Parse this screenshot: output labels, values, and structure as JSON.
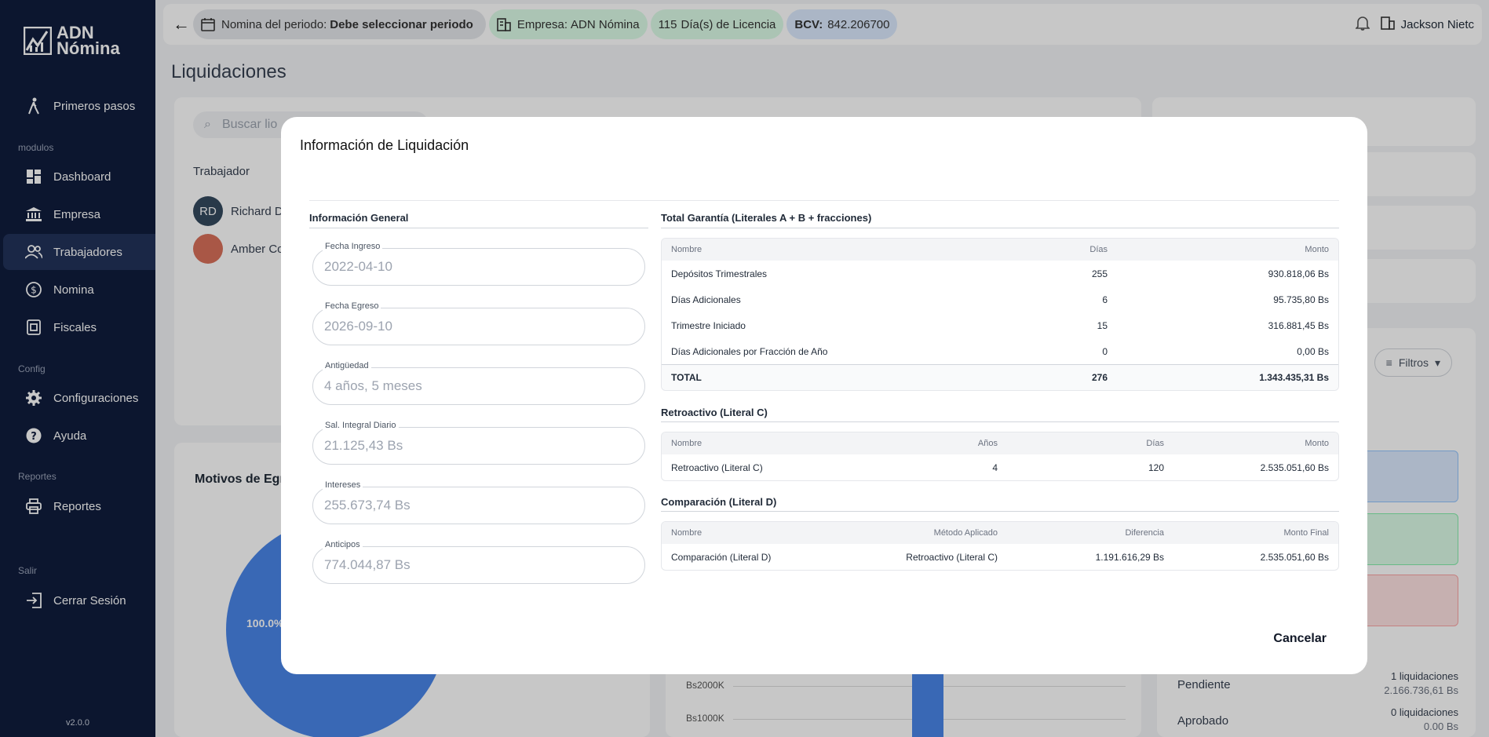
{
  "brand": {
    "line1": "ADN",
    "line2": "Nómina"
  },
  "sidebar": {
    "items": [
      {
        "label": "Primeros pasos",
        "icon": "walk-icon"
      },
      {
        "label": "Dashboard",
        "icon": "dashboard-icon"
      },
      {
        "label": "Empresa",
        "icon": "bank-icon"
      },
      {
        "label": "Trabajadores",
        "icon": "people-icon"
      },
      {
        "label": "Nomina",
        "icon": "money-icon"
      },
      {
        "label": "Fiscales",
        "icon": "receipt-icon"
      },
      {
        "label": "Configuraciones",
        "icon": "gear-icon"
      },
      {
        "label": "Ayuda",
        "icon": "help-icon"
      },
      {
        "label": "Reportes",
        "icon": "printer-icon"
      },
      {
        "label": "Cerrar Sesión",
        "icon": "logout-icon"
      }
    ],
    "sections": [
      "modulos",
      "Config",
      "Reportes",
      "Salir"
    ],
    "version": "v2.0.0"
  },
  "topbar": {
    "periodo_label": "Nomina del periodo:",
    "periodo_value": "Debe seleccionar periodo",
    "empresa_label": "Empresa:",
    "empresa_value": "ADN Nómina",
    "licencia_num": "115",
    "licencia_text": "Día(s) de Licencia",
    "bcv_label": "BCV:",
    "bcv_value": "842.206700",
    "user": "Jackson Nietc"
  },
  "page": {
    "title": "Liquidaciones",
    "search_placeholder": "Buscar lio",
    "col_trabajador": "Trabajador",
    "workers": [
      {
        "initials": "RD",
        "name": "Richard D"
      },
      {
        "initials": "",
        "name": "Amber Co"
      }
    ],
    "motivos_title": "Motivos de Egre",
    "pie_label": "100.0%",
    "filtros": "Filtros",
    "bar_ticks": [
      "Bs2000K",
      "Bs1000K"
    ],
    "status": [
      {
        "label": "Pendiente",
        "count": "1 liquidaciones",
        "amount": "2.166.736,61 Bs"
      },
      {
        "label": "Aprobado",
        "count": "0 liquidaciones",
        "amount": "0.00 Bs"
      }
    ]
  },
  "modal": {
    "title": "Información de Liquidación",
    "general_title": "Información General",
    "fields": [
      {
        "label": "Fecha Ingreso",
        "value": "2022-04-10"
      },
      {
        "label": "Fecha Egreso",
        "value": "2026-09-10"
      },
      {
        "label": "Antigüedad",
        "value": "4 años, 5 meses"
      },
      {
        "label": "Sal. Integral Diario",
        "value": "21.125,43 Bs"
      },
      {
        "label": "Intereses",
        "value": "255.673,74 Bs"
      },
      {
        "label": "Anticipos",
        "value": "774.044,87 Bs"
      }
    ],
    "garantia": {
      "title": "Total Garantía (Literales A + B + fracciones)",
      "headers": [
        "Nombre",
        "Días",
        "Monto"
      ],
      "rows": [
        [
          "Depósitos Trimestrales",
          "255",
          "930.818,06 Bs"
        ],
        [
          "Días Adicionales",
          "6",
          "95.735,80 Bs"
        ],
        [
          "Trimestre Iniciado",
          "15",
          "316.881,45 Bs"
        ],
        [
          "Días Adicionales por Fracción de Año",
          "0",
          "0,00 Bs"
        ]
      ],
      "total": [
        "TOTAL",
        "276",
        "1.343.435,31 Bs"
      ]
    },
    "retroactivo": {
      "title": "Retroactivo (Literal C)",
      "headers": [
        "Nombre",
        "Años",
        "Días",
        "Monto"
      ],
      "row": [
        "Retroactivo (Literal C)",
        "4",
        "120",
        "2.535.051,60 Bs"
      ]
    },
    "comparacion": {
      "title": "Comparación (Literal D)",
      "headers": [
        "Nombre",
        "Método Aplicado",
        "Diferencia",
        "Monto Final"
      ],
      "row": [
        "Comparación (Literal D)",
        "Retroactivo (Literal C)",
        "1.191.616,29 Bs",
        "2.535.051,60 Bs"
      ]
    },
    "cancel": "Cancelar"
  }
}
